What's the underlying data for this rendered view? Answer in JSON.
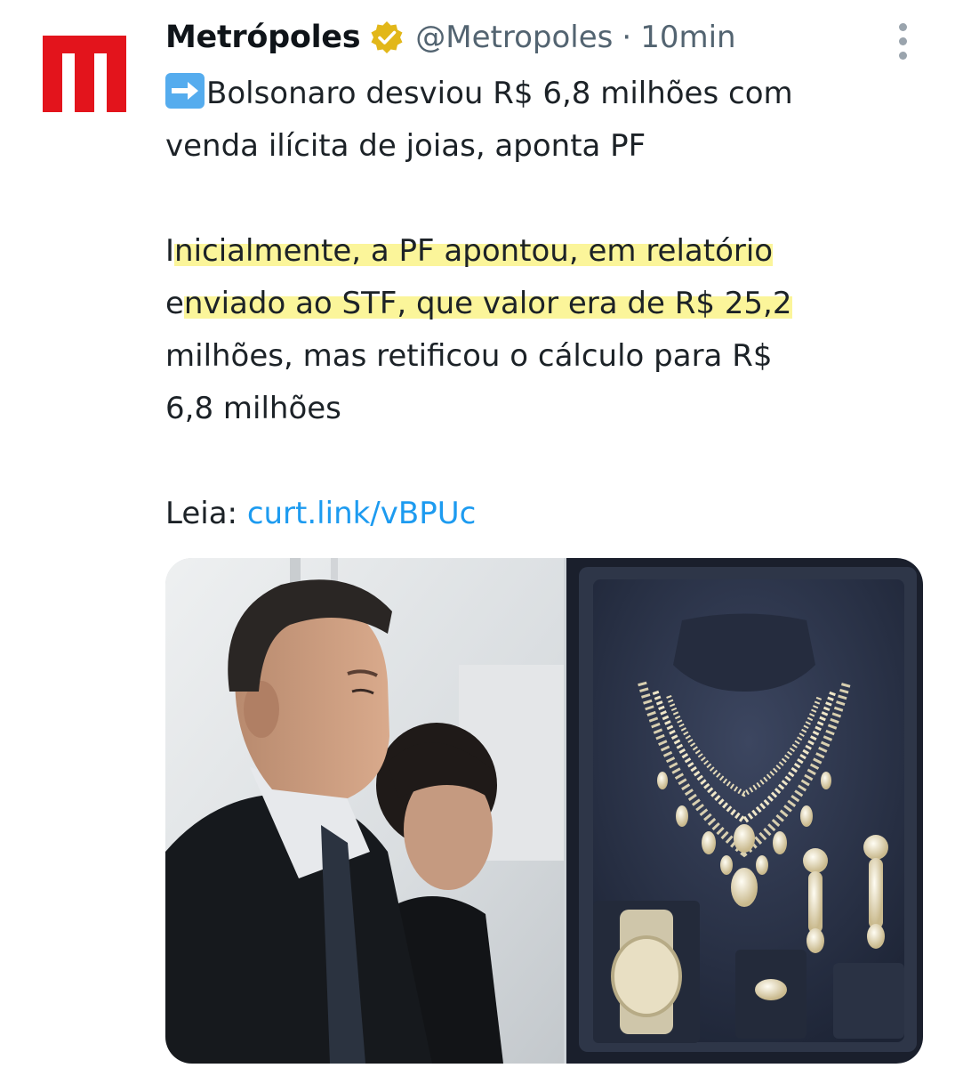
{
  "tweet": {
    "author": {
      "display_name": "Metrópoles",
      "handle": "@Metropoles",
      "verified": true,
      "avatar_icon": "metropoles-m-logo",
      "avatar_color": "#e3141c"
    },
    "separator": "·",
    "timestamp": "10min",
    "more_icon": "more-vertical-icon",
    "body": {
      "emoji": "arrow-right-emoji",
      "headline_line1": "Bolsonaro desviou R$ 6,8 milhões com",
      "headline_line2": "venda ilícita de joias, aponta PF",
      "para_line1_pre": "I",
      "para_line1_hl": "nicialmente, a PF apontou, em relatório",
      "para_line2_pre": "e",
      "para_line2_hl": "nviado ao STF, que valor era de R$ 25,2",
      "para_line3": "milhões, mas retificou o cálculo para R$",
      "para_line4": "6,8 milhões",
      "read_label": "Leia:",
      "link_text": "curt.link/vBPUc",
      "highlight_color": "#fbf59a",
      "link_color": "#1d9bf0"
    },
    "media": {
      "images": [
        {
          "name": "photo-bolsonaro-couple"
        },
        {
          "name": "photo-jewelry-set"
        }
      ]
    }
  }
}
